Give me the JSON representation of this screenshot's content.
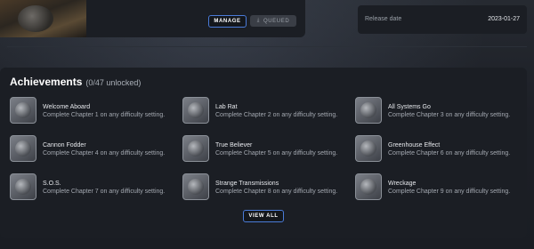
{
  "header": {
    "manage_label": "MANAGE",
    "queued_label": "QUEUED",
    "queued_icon": "download-icon"
  },
  "release": {
    "label": "Release date",
    "value": "2023-01-27"
  },
  "achievements": {
    "title": "Achievements",
    "count": "(0/47 unlocked)",
    "view_all_label": "VIEW ALL",
    "items": [
      {
        "name": "Welcome Aboard",
        "desc": "Complete Chapter 1 on any difficulty setting."
      },
      {
        "name": "Lab Rat",
        "desc": "Complete Chapter 2 on any difficulty setting."
      },
      {
        "name": "All Systems Go",
        "desc": "Complete Chapter 3 on any difficulty setting."
      },
      {
        "name": "Cannon Fodder",
        "desc": "Complete Chapter 4 on any difficulty setting."
      },
      {
        "name": "True Believer",
        "desc": "Complete Chapter 5 on any difficulty setting."
      },
      {
        "name": "Greenhouse Effect",
        "desc": "Complete Chapter 6 on any difficulty setting."
      },
      {
        "name": "S.O.S.",
        "desc": "Complete Chapter 7 on any difficulty setting."
      },
      {
        "name": "Strange Transmissions",
        "desc": "Complete Chapter 8 on any difficulty setting."
      },
      {
        "name": "Wreckage",
        "desc": "Complete Chapter 9 on any difficulty setting."
      }
    ]
  },
  "colors": {
    "accent": "#4a7bd8",
    "card_bg": "#1b1e24"
  }
}
